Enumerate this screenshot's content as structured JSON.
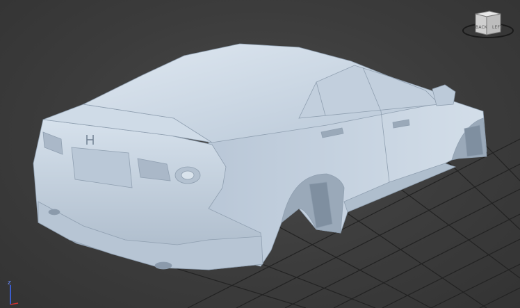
{
  "viewport": {
    "background_color": "#3c3c3c",
    "grid_color": "#1e1e1e",
    "model_color": "#c5d3e2"
  },
  "viewcube": {
    "label_back": "BACK",
    "label_left": "LEFT",
    "icon": "viewcube-icon"
  },
  "axis_gizmo": {
    "z_label": "z",
    "icon": "axis-tripod-icon"
  },
  "model": {
    "icon": "car-model-icon"
  }
}
